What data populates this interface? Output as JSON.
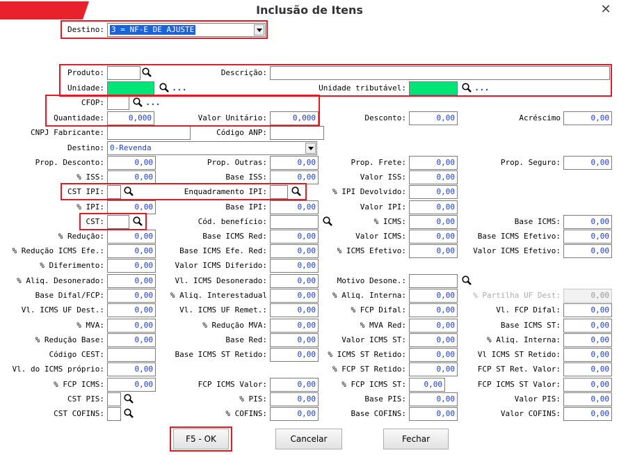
{
  "window": {
    "title": "Inclusão de Itens",
    "close": "✕"
  },
  "header": {
    "destino_label": "Destino:",
    "destino_value": "3 = NF-E DE AJUSTE"
  },
  "produto": {
    "produto_label": "Produto:",
    "descricao_label": "Descrição:",
    "unidade_label": "Unidade:",
    "unidade_trib_label": "Unidade tributável:",
    "dots": "...",
    "produto_value": "",
    "descricao_value": ""
  },
  "fields": {
    "cfop": {
      "label": "CFOP:",
      "value": ""
    },
    "quantidade": {
      "label": "Quantidade:",
      "value": "0,000"
    },
    "valor_unitario": {
      "label": "Valor Unitário:",
      "value": "0,000"
    },
    "desconto": {
      "label": "Desconto:",
      "value": "0,00"
    },
    "acrescimo": {
      "label": "Acréscimo",
      "value": "0,00"
    },
    "cnpj_fabricante": {
      "label": "CNPJ Fabricante:",
      "value": ""
    },
    "codigo_anp": {
      "label": "Código ANP:",
      "value": ""
    },
    "destino2": {
      "label": "Destino:",
      "value": "0-Revenda"
    },
    "prop_desconto": {
      "label": "Prop. Desconto:",
      "value": "0,00"
    },
    "prop_outras": {
      "label": "Prop. Outras:",
      "value": "0,00"
    },
    "prop_frete": {
      "label": "Prop. Frete:",
      "value": "0,00"
    },
    "prop_seguro": {
      "label": "Prop. Seguro:",
      "value": "0,00"
    },
    "pct_iss": {
      "label": "% ISS:",
      "value": "0,00"
    },
    "base_iss": {
      "label": "Base ISS:",
      "value": "0,00"
    },
    "valor_iss": {
      "label": "Valor ISS:",
      "value": "0,00"
    },
    "cst_ipi": {
      "label": "CST IPI:",
      "value": ""
    },
    "enquadramento_ipi": {
      "label": "Enquadramento IPI:",
      "value": ""
    },
    "pct_ipi_devolvido": {
      "label": "% IPI Devolvido:",
      "value": "0,00"
    },
    "pct_ipi": {
      "label": "% IPI:",
      "value": "0,00"
    },
    "base_ipi": {
      "label": "Base IPI:",
      "value": "0,00"
    },
    "valor_ipi": {
      "label": "Valor IPI:",
      "value": "0,00"
    },
    "cst": {
      "label": "CST:",
      "value": ""
    },
    "cod_beneficio": {
      "label": "Cód. benefício:",
      "value": ""
    },
    "pct_icms": {
      "label": "% ICMS:",
      "value": "0,00"
    },
    "base_icms": {
      "label": "Base ICMS:",
      "value": "0,00"
    },
    "pct_reducao": {
      "label": "% Redução:",
      "value": "0,00"
    },
    "base_icms_red": {
      "label": "Base ICMS Red:",
      "value": "0,00"
    },
    "valor_icms": {
      "label": "Valor ICMS:",
      "value": "0,00"
    },
    "base_icms_efetivo": {
      "label": "Base ICMS Efetivo:",
      "value": "0,00"
    },
    "pct_red_icms_efe": {
      "label": "% Redução ICMS Efe.:",
      "value": "0,00"
    },
    "base_icms_efe_red": {
      "label": "Base ICMS Efe. Red:",
      "value": "0,00"
    },
    "pct_icms_efetivo": {
      "label": "% ICMS Efetivo:",
      "value": "0,00"
    },
    "valor_icms_efetivo": {
      "label": "Valor ICMS Efetivo:",
      "value": "0,00"
    },
    "pct_diferimento": {
      "label": "% Diferimento:",
      "value": "0,00"
    },
    "valor_icms_diferido": {
      "label": "Valor ICMS Diferido:",
      "value": "0,00"
    },
    "pct_aliq_desonerado": {
      "label": "% Aliq. Desonerado:",
      "value": "0,00"
    },
    "vl_icms_desonerado": {
      "label": "Vl. ICMS Desonerado:",
      "value": "0,00"
    },
    "motivo_desone": {
      "label": "Motivo Desone.:",
      "value": ""
    },
    "base_difal_fcp": {
      "label": "Base Difal/FCP:",
      "value": "0,00"
    },
    "pct_aliq_interestadual": {
      "label": "% Aliq. Interestadual",
      "value": "0,00"
    },
    "pct_aliq_interna": {
      "label": "% Aliq. Interna:",
      "value": "0,00"
    },
    "pct_partilha_uf_dest": {
      "label": "% Partilha UF Dest:",
      "value": "0,00"
    },
    "vl_icms_uf_dest": {
      "label": "Vl. ICMS UF Dest.:",
      "value": "0,00"
    },
    "vl_icms_uf_remet": {
      "label": "Vl. ICMS UF Remet.:",
      "value": "0,00"
    },
    "pct_fcp_difal": {
      "label": "% FCP Difal:",
      "value": "0,00"
    },
    "vl_fcp_difal": {
      "label": "Vl. FCP Difal:",
      "value": "0,00"
    },
    "pct_mva": {
      "label": "% MVA:",
      "value": "0,00"
    },
    "pct_reducao_mva": {
      "label": "% Redução MVA:",
      "value": "0,00"
    },
    "pct_mva_red": {
      "label": "% MVA Red:",
      "value": "0,00"
    },
    "base_icms_st": {
      "label": "Base ICMS ST:",
      "value": "0,00"
    },
    "pct_reducao_base": {
      "label": "% Redução Base:",
      "value": "0,00"
    },
    "base_red": {
      "label": "Base Red:",
      "value": "0,00"
    },
    "valor_icms_st": {
      "label": "Valor ICMS ST:",
      "value": "0,00"
    },
    "pct_aliq_interna2": {
      "label": "% Aliq. Interna:",
      "value": "0,00"
    },
    "codigo_cest": {
      "label": "Código CEST:",
      "value": ""
    },
    "base_icms_st_retido": {
      "label": "Base ICMS ST Retido:",
      "value": "0,00"
    },
    "pct_icms_st_retido": {
      "label": "% ICMS ST Retido:",
      "value": "0,00"
    },
    "vl_icms_st_retido": {
      "label": "Vl ICMS ST Retido:",
      "value": "0,00"
    },
    "vl_icms_proprio": {
      "label": "Vl. do ICMS próprio:",
      "value": "0,00"
    },
    "pct_fcp_st_retido": {
      "label": "% FCP ST Retido:",
      "value": "0,00"
    },
    "fcp_st_ret_valor": {
      "label": "FCP ST Ret. Valor:",
      "value": "0,00"
    },
    "pct_fcp_icms": {
      "label": "% FCP ICMS:",
      "value": "0,00"
    },
    "fcp_icms_valor": {
      "label": "FCP ICMS Valor:",
      "value": "0,00"
    },
    "pct_fcp_icms_st": {
      "label": "% FCP ICMS ST:",
      "value": "0,00"
    },
    "fcp_icms_st_valor": {
      "label": "FCP ICMS ST Valor:",
      "value": "0,00"
    },
    "cst_pis": {
      "label": "CST PIS:",
      "value": ""
    },
    "pct_pis": {
      "label": "% PIS:",
      "value": "0,00"
    },
    "base_pis": {
      "label": "Base PIS:",
      "value": "0,00"
    },
    "valor_pis": {
      "label": "Valor PIS:",
      "value": "0,00"
    },
    "cst_cofins": {
      "label": "CST COFINS:",
      "value": ""
    },
    "pct_cofins": {
      "label": "% COFINS:",
      "value": "0,00"
    },
    "base_cofins": {
      "label": "Base COFINS:",
      "value": "0,00"
    },
    "valor_cofins": {
      "label": "Valor COFINS:",
      "value": "0,00"
    }
  },
  "buttons": {
    "ok": "F5 - OK",
    "cancelar": "Cancelar",
    "fechar": "Fechar"
  },
  "colors": {
    "accent_red": "#e01b24",
    "value_blue": "#1a3fb8",
    "unit_green": "#00e676",
    "selection_blue": "#1e63d6"
  },
  "icons": {
    "lookup": "magnifier-icon",
    "close": "close-icon",
    "dropdown": "chevron-down-icon"
  }
}
